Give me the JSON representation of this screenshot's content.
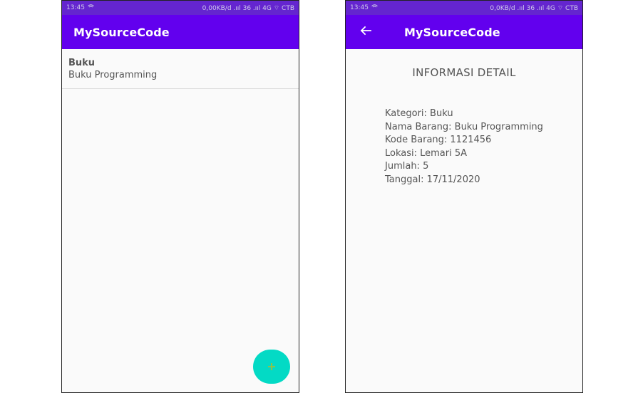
{
  "left_screen": {
    "status": {
      "time": "13:45",
      "right": "0,00KB/d  .ııl 36  .ııl 4G  ⌔  CTB"
    },
    "appbar": {
      "title": "MySourceCode"
    },
    "list": [
      {
        "title": "Buku",
        "subtitle": "Buku Programming"
      }
    ],
    "fab": {
      "icon": "plus-icon",
      "color": "#03dac5",
      "icon_color": "#8bc34a"
    }
  },
  "right_screen": {
    "status": {
      "time": "13:45",
      "right": "0,0KB/d  .ııl 36  .ııl 4G  ⌔  CTB"
    },
    "appbar": {
      "title": "MySourceCode",
      "back_icon": "arrow-back-icon"
    },
    "heading": "INFORMASI DETAIL",
    "details": [
      "Kategori: Buku",
      "Nama Barang: Buku Programming",
      "Kode Barang: 1121456",
      "Lokasi: Lemari 5A",
      "Jumlah: 5",
      "Tanggal: 17/11/2020"
    ]
  },
  "colors": {
    "primary": "#6200ee",
    "status_bar": "#4b00c8",
    "accent": "#03dac5"
  }
}
